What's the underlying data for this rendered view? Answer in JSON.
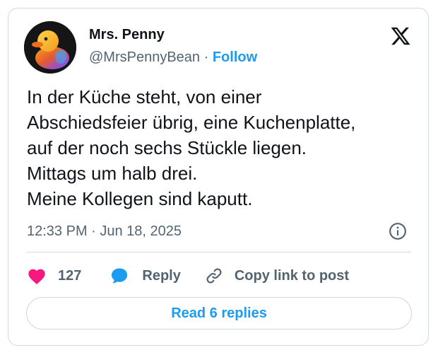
{
  "author": {
    "display_name": "Mrs. Penny",
    "handle": "@MrsPennyBean",
    "separator": " · ",
    "follow_label": "Follow",
    "avatar": "rubber-duck-avatar"
  },
  "tweet": {
    "lines": [
      "In der Küche steht, von einer",
      "Abschiedsfeier übrig, eine Kuchenplatte,",
      "auf der noch sechs Stückle liegen.",
      "Mittags um halb drei.",
      "Meine Kollegen sind kaputt."
    ],
    "timestamp": "12:33 PM · Jun 18, 2025"
  },
  "actions": {
    "like_count": "127",
    "reply_label": "Reply",
    "copy_link_label": "Copy link to post"
  },
  "footer": {
    "read_replies_label": "Read 6 replies"
  },
  "icons": {
    "brand": "x-logo-icon",
    "info": "info-icon",
    "like": "heart-icon",
    "reply": "speech-bubble-icon",
    "copy": "link-icon"
  },
  "colors": {
    "accent": "#1d9bf0",
    "like": "#f91880",
    "text": "#0f1419",
    "muted": "#536471",
    "border": "#cfd9de"
  }
}
